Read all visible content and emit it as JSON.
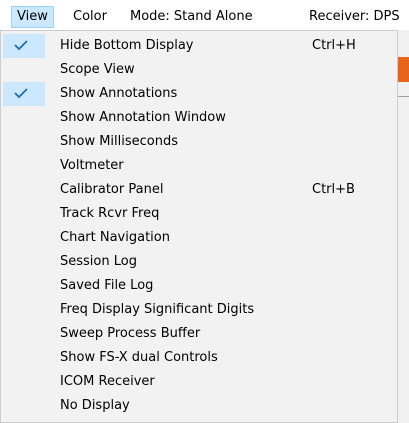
{
  "menubar": {
    "items": [
      {
        "label": "View",
        "active": true
      },
      {
        "label": "Color",
        "active": false
      },
      {
        "label": "Mode: Stand Alone",
        "active": false
      },
      {
        "label": "Receiver: DPS",
        "active": false
      }
    ]
  },
  "dropdown": {
    "items": [
      {
        "label": "Hide Bottom Display",
        "shortcut": "Ctrl+H",
        "checked": true
      },
      {
        "label": "Scope View",
        "shortcut": "",
        "checked": false
      },
      {
        "label": "Show Annotations",
        "shortcut": "",
        "checked": true
      },
      {
        "label": "Show Annotation Window",
        "shortcut": "",
        "checked": false
      },
      {
        "label": "Show Milliseconds",
        "shortcut": "",
        "checked": false
      },
      {
        "label": "Voltmeter",
        "shortcut": "",
        "checked": false
      },
      {
        "label": "Calibrator Panel",
        "shortcut": "Ctrl+B",
        "checked": false
      },
      {
        "label": "Track Rcvr Freq",
        "shortcut": "",
        "checked": false
      },
      {
        "label": "Chart Navigation",
        "shortcut": "",
        "checked": false
      },
      {
        "label": "Session Log",
        "shortcut": "",
        "checked": false
      },
      {
        "label": "Saved File Log",
        "shortcut": "",
        "checked": false
      },
      {
        "label": "Freq Display Significant Digits",
        "shortcut": "",
        "checked": false
      },
      {
        "label": "Sweep Process Buffer",
        "shortcut": "",
        "checked": false
      },
      {
        "label": "Show FS-X dual Controls",
        "shortcut": "",
        "checked": false
      },
      {
        "label": "ICOM Receiver",
        "shortcut": "",
        "checked": false
      },
      {
        "label": "No Display",
        "shortcut": "",
        "checked": false
      }
    ]
  },
  "colors": {
    "highlight": "#cce8ff",
    "check": "#1a6fb5"
  }
}
